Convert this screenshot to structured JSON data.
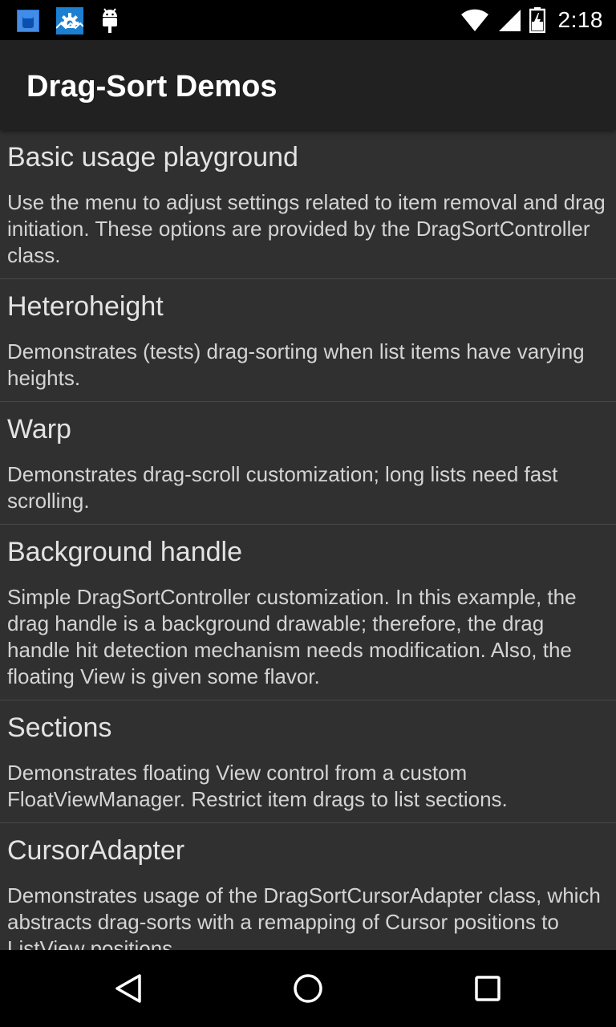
{
  "status_bar": {
    "time": "2:18",
    "left_icons": [
      "app-notification-icon",
      "settings-gear-notification-icon",
      "android-debug-icon"
    ],
    "right_icons": [
      "wifi-icon",
      "cellular-signal-icon",
      "battery-charging-icon"
    ]
  },
  "app_bar": {
    "title": "Drag-Sort Demos"
  },
  "demos": [
    {
      "title": "Basic usage playground",
      "description": "Use the menu to adjust settings related to item removal and drag initiation. These options are provided by the DragSortController class."
    },
    {
      "title": "Heteroheight",
      "description": "Demonstrates (tests) drag-sorting when list items have varying heights."
    },
    {
      "title": "Warp",
      "description": "Demonstrates drag-scroll customization; long lists need fast scrolling."
    },
    {
      "title": "Background handle",
      "description": "Simple DragSortController customization. In this example, the drag handle is a background drawable; therefore, the drag handle hit detection mechanism needs modification. Also, the floating View is given some flavor."
    },
    {
      "title": "Sections",
      "description": "Demonstrates floating View control from a custom FloatViewManager. Restrict item drags to list sections."
    },
    {
      "title": "CursorAdapter",
      "description": "Demonstrates usage of the DragSortCursorAdapter class, which abstracts drag-sorts with a remapping of Cursor positions to ListView positions."
    }
  ],
  "nav_bar": {
    "buttons": [
      "back-icon",
      "home-icon",
      "recents-icon"
    ]
  },
  "colors": {
    "status_bar_bg": "#000000",
    "app_bar_bg": "#212121",
    "list_bg": "#303030",
    "divider": "#474747",
    "title_text": "#e3e3e3",
    "body_text": "#d4d4d4"
  }
}
